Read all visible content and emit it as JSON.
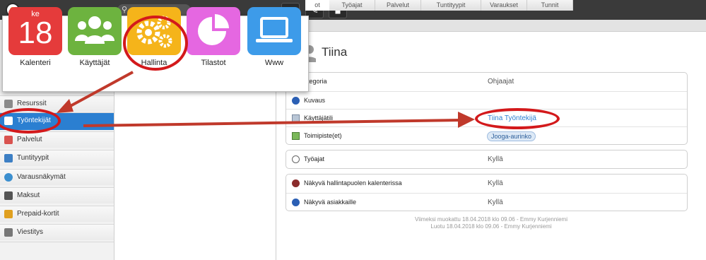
{
  "apps": [
    {
      "label": "Kalenteri",
      "color": "#e53b3b",
      "day_name": "ke",
      "day_number": "18",
      "icon": "calendar-icon"
    },
    {
      "label": "Käyttäjät",
      "color": "#6db33f",
      "icon": "users-icon"
    },
    {
      "label": "Hallinta",
      "color": "#f5b41a",
      "icon": "gears-icon"
    },
    {
      "label": "Tilastot",
      "color": "#e567e1",
      "icon": "pie-chart-icon"
    },
    {
      "label": "Www",
      "color": "#3d9be9",
      "icon": "laptop-icon"
    }
  ],
  "toolbar": {
    "add": "+",
    "edit": "✎",
    "delete": "🗑"
  },
  "sidebar": {
    "items": [
      {
        "label": "Resurssit",
        "icon": "resources-icon",
        "color": "#8a8a8a"
      },
      {
        "label": "Työntekijät",
        "icon": "employees-icon",
        "color": "#2b7fd1",
        "active": true
      },
      {
        "label": "Palvelut",
        "icon": "services-icon",
        "color": "#d9534f"
      },
      {
        "label": "Tuntityypit",
        "icon": "hour-types-icon",
        "color": "#3d7fc4"
      },
      {
        "label": "Varausnäkymät",
        "icon": "booking-views-icon",
        "color": "#3c8fcf"
      },
      {
        "label": "Maksut",
        "icon": "payments-icon",
        "color": "#555555"
      },
      {
        "label": "Prepaid-kortit",
        "icon": "prepaid-cards-icon",
        "color": "#e0a020"
      },
      {
        "label": "Viestitys",
        "icon": "messaging-icon",
        "color": "#777777"
      }
    ]
  },
  "tabs": [
    {
      "label": "ot"
    },
    {
      "label": "Työajat"
    },
    {
      "label": "Palvelut"
    },
    {
      "label": "Tuntityypit"
    },
    {
      "label": "Varaukset"
    },
    {
      "label": "Tunnit"
    }
  ],
  "person": {
    "name": "Tiina"
  },
  "details": {
    "kategoria_label": "ategoria",
    "kategoria_value": "Ohjaajat",
    "kuvaus_label": "Kuvaus",
    "kayttajatili_label": "Käyttäjätili",
    "kayttajatili_value": "Tiina Työntekijä",
    "toimipiste_label": "Toimipiste(et)",
    "toimipiste_value": "Jooga-aurinko",
    "tyoajat_label": "Työajat",
    "tyoajat_value": "Kyllä",
    "nakyva_hallinta_label": "Näkyvä hallintapuolen kalenterissa",
    "nakyva_hallinta_value": "Kyllä",
    "nakyva_asiakkaille_label": "Näkyvä asiakkaille",
    "nakyva_asiakkaille_value": "Kyllä"
  },
  "footer": {
    "modified": "Viimeksi muokattu 18.04.2018 klo 09.06 - Emmy Kurjenniemi",
    "created": "Luotu 18.04.2018 klo 09.06 - Emmy Kurjenniemi"
  }
}
